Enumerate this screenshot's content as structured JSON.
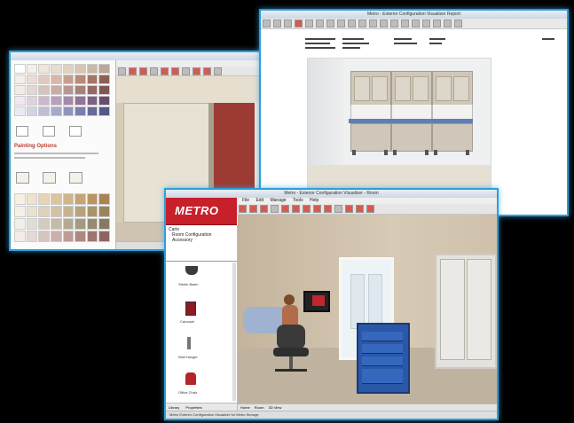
{
  "windows": {
    "left": {
      "painting_options_title": "Painting Options",
      "colors": {
        "palette_top": [
          "#ffffff",
          "#f4efe8",
          "#efe6d8",
          "#e8dccc",
          "#e0d2bf",
          "#d8c6b2",
          "#cbb9a6",
          "#bba895",
          "#f6eee9",
          "#ecdcd3",
          "#e2c9bd",
          "#d8b6a8",
          "#c79f91",
          "#b88a7c",
          "#a67566",
          "#8f6050",
          "#f2ece8",
          "#e4d6d2",
          "#d6c1bd",
          "#c8aca8",
          "#b99691",
          "#a8807c",
          "#956a66",
          "#805653",
          "#efe9ef",
          "#ddd1e0",
          "#cbb8cf",
          "#b8a0bd",
          "#a689ab",
          "#927497",
          "#7d6084",
          "#684d6e",
          "#e9e9f1",
          "#d2d3e3",
          "#bcbed6",
          "#a6a9c9",
          "#9094ba",
          "#7a7fab",
          "#666b99",
          "#545987"
        ],
        "palette_bottom": [
          "#f7f1e4",
          "#efe3cc",
          "#e6d4b4",
          "#dcc59d",
          "#d1b587",
          "#c6a573",
          "#b99461",
          "#a98452",
          "#f4f0e8",
          "#e9e1d1",
          "#ddd1ba",
          "#d1c2a4",
          "#c5b38f",
          "#b8a47b",
          "#aa9569",
          "#9b8659",
          "#f1efe9",
          "#e2ddd3",
          "#d3ccbd",
          "#c4bba8",
          "#b4aa94",
          "#a59a81",
          "#968a70",
          "#867b61",
          "#f3ece9",
          "#e6d8d4",
          "#d8c4bf",
          "#cbb0ab",
          "#bd9c96",
          "#ae8882",
          "#9f756f",
          "#8f635e"
        ],
        "wall": "#e8e2d4",
        "accent_wall": "#9c3b33",
        "floor": "#cfc3b2"
      }
    },
    "right": {
      "title": "Metro - Exterior Configuration Visualizer Report",
      "colors": {
        "page_bg": "#ffffff",
        "room_wall": "#e8ebee",
        "room_floor": "#e6e0d4",
        "cabinet_frame": "#b9b1a5",
        "countertop": "#5f7fb0"
      }
    },
    "bottom": {
      "brand_name": "METRO",
      "title": "Metro - Exterior Configuration Visualizer - Room",
      "menu": [
        "File",
        "Edit",
        "Manage",
        "Tools",
        "Help"
      ],
      "tree_items": [
        "Carts",
        "Room Configuration",
        "Accessory"
      ],
      "catalog_items": [
        "Sterile Basin",
        "Carousel",
        "Wall Hanger",
        "Office Chair"
      ],
      "tabs": [
        "Library",
        "Properties"
      ],
      "view_tabs": [
        "Home",
        "Room",
        "3D View"
      ],
      "status_text": "Metro Exterior Configuration Visualizer for Metro Storage",
      "colors": {
        "brand_red": "#c7202b",
        "room_wall": "#c9b9a3",
        "room_floor": "#b9ad9a",
        "cart": "#2b57a8",
        "chair": "#3a3a3a"
      }
    }
  }
}
